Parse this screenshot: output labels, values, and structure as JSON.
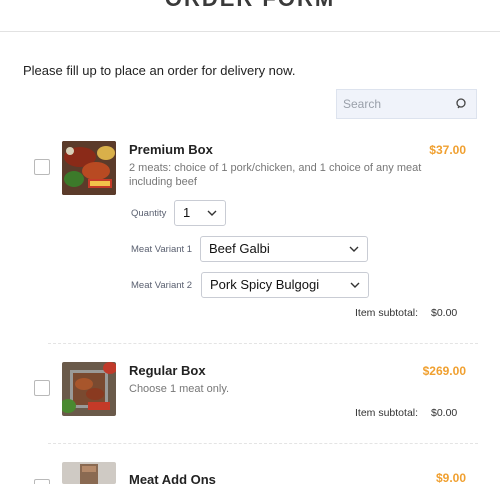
{
  "header": {
    "title": "ORDER FORM"
  },
  "intro_text": "Please fill up to place an order for delivery now.",
  "search": {
    "placeholder": "Search"
  },
  "products": [
    {
      "name": "Premium Box",
      "price": "$37.00",
      "description": "2 meats: choice of 1 pork/chicken, and 1 choice of any meat including beef",
      "quantity_label": "Quantity",
      "quantity_value": "1",
      "variant1_label": "Meat Variant 1",
      "variant1_value": "Beef Galbi",
      "variant2_label": "Meat Variant 2",
      "variant2_value": "Pork Spicy Bulgogi",
      "subtotal_label": "Item subtotal:",
      "subtotal_value": "$0.00"
    },
    {
      "name": "Regular Box",
      "price": "$269.00",
      "description": "Choose 1 meat only.",
      "subtotal_label": "Item subtotal:",
      "subtotal_value": "$0.00"
    },
    {
      "name": "Meat Add Ons",
      "price": "$9.00"
    }
  ],
  "colors": {
    "price": "#f0a030",
    "divider": "#e2e2e2",
    "search_bg": "#f0f3fa"
  }
}
